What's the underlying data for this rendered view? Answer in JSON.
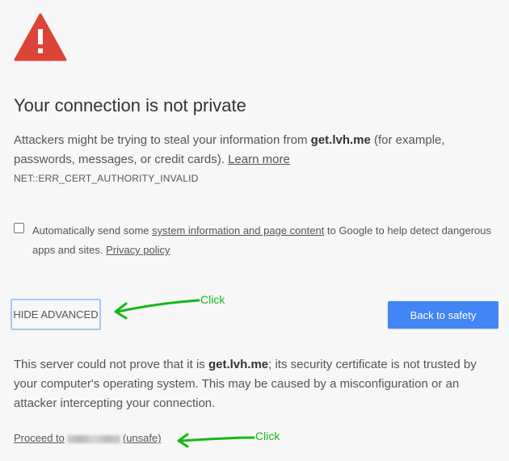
{
  "icon": "warning-triangle-icon",
  "title": "Your connection is not private",
  "description": {
    "before": "Attackers might be trying to steal your information from ",
    "host": "get.lvh.me",
    "after": " (for example, passwords, messages, or credit cards). ",
    "learn_more": "Learn more"
  },
  "error_code": "NET::ERR_CERT_AUTHORITY_INVALID",
  "reporting": {
    "before": "Automatically send some ",
    "link1": "system information and page content",
    "middle": " to Google to help detect dangerous apps and sites. ",
    "link2": "Privacy policy"
  },
  "buttons": {
    "hide_advanced": "HIDE ADVANCED",
    "back_to_safety": "Back to safety"
  },
  "annotations": {
    "click1": "Click",
    "click2": "Click",
    "color": "#14b814"
  },
  "details": {
    "before": "This server could not prove that it is ",
    "host": "get.lvh.me",
    "after": "; its security certificate is not trusted by your computer's operating system. This may be caused by a misconfiguration or an attacker intercepting your connection."
  },
  "proceed": {
    "before": "Proceed to",
    "after": "(unsafe)"
  },
  "colors": {
    "primary_button": "#4285f4",
    "warning_red": "#db4437",
    "background": "#f7f7f7"
  }
}
